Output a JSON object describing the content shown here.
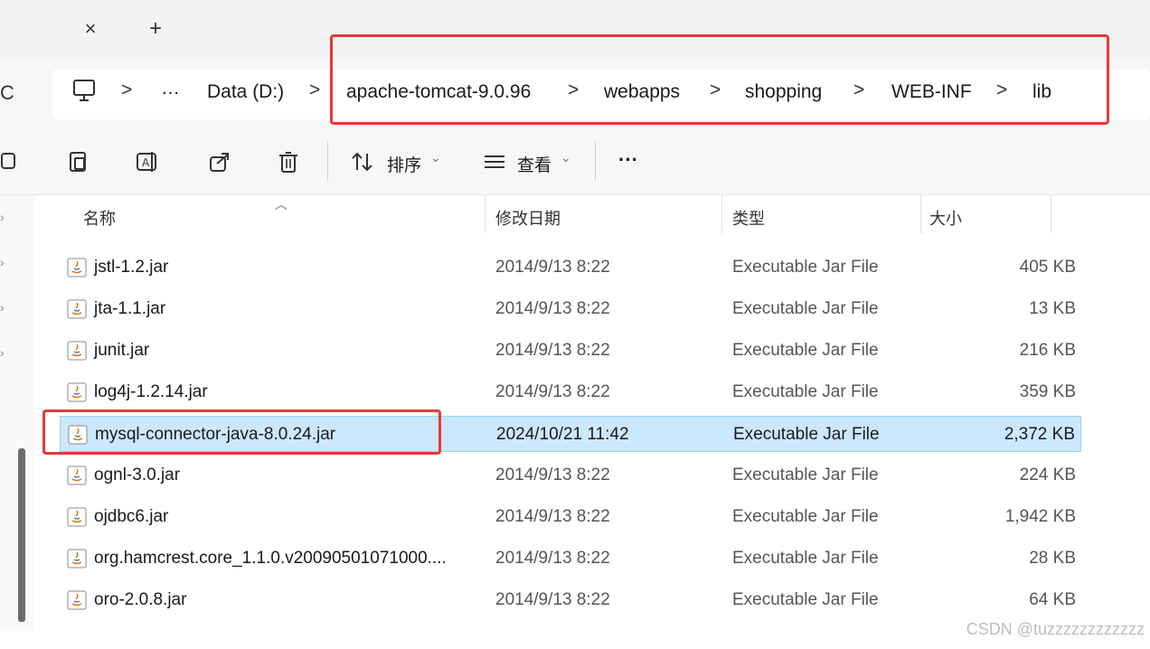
{
  "tabs": {
    "close_glyph": "×",
    "new_glyph": "+"
  },
  "address": {
    "refresh_glyph": "C",
    "crumbs": [
      "…",
      "Data (D:)",
      "apache-tomcat-9.0.96",
      "webapps",
      "shopping",
      "WEB-INF",
      "lib"
    ],
    "separator": ">"
  },
  "toolbar": {
    "sort_label": "排序",
    "view_label": "查看",
    "more_label": "···",
    "dropdown_glyph": "⌄"
  },
  "columns": {
    "name": "名称",
    "date": "修改日期",
    "type": "类型",
    "size": "大小"
  },
  "files": [
    {
      "name": "jstl-1.2.jar",
      "date": "2014/9/13 8:22",
      "type": "Executable Jar File",
      "size": "405 KB"
    },
    {
      "name": "jta-1.1.jar",
      "date": "2014/9/13 8:22",
      "type": "Executable Jar File",
      "size": "13 KB"
    },
    {
      "name": "junit.jar",
      "date": "2014/9/13 8:22",
      "type": "Executable Jar File",
      "size": "216 KB"
    },
    {
      "name": "log4j-1.2.14.jar",
      "date": "2014/9/13 8:22",
      "type": "Executable Jar File",
      "size": "359 KB"
    },
    {
      "name": "mysql-connector-java-8.0.24.jar",
      "date": "2024/10/21 11:42",
      "type": "Executable Jar File",
      "size": "2,372 KB",
      "selected": true
    },
    {
      "name": "ognl-3.0.jar",
      "date": "2014/9/13 8:22",
      "type": "Executable Jar File",
      "size": "224 KB"
    },
    {
      "name": "ojdbc6.jar",
      "date": "2014/9/13 8:22",
      "type": "Executable Jar File",
      "size": "1,942 KB"
    },
    {
      "name": "org.hamcrest.core_1.1.0.v20090501071000....",
      "date": "2014/9/13 8:22",
      "type": "Executable Jar File",
      "size": "28 KB"
    },
    {
      "name": "oro-2.0.8.jar",
      "date": "2014/9/13 8:22",
      "type": "Executable Jar File",
      "size": "64 KB"
    }
  ],
  "colors": {
    "highlight": "#e53935",
    "selected_bg": "#cce8ff",
    "selected_border": "#99d1ff"
  },
  "watermark": "CSDN @tuzzzzzzzzzzzz"
}
